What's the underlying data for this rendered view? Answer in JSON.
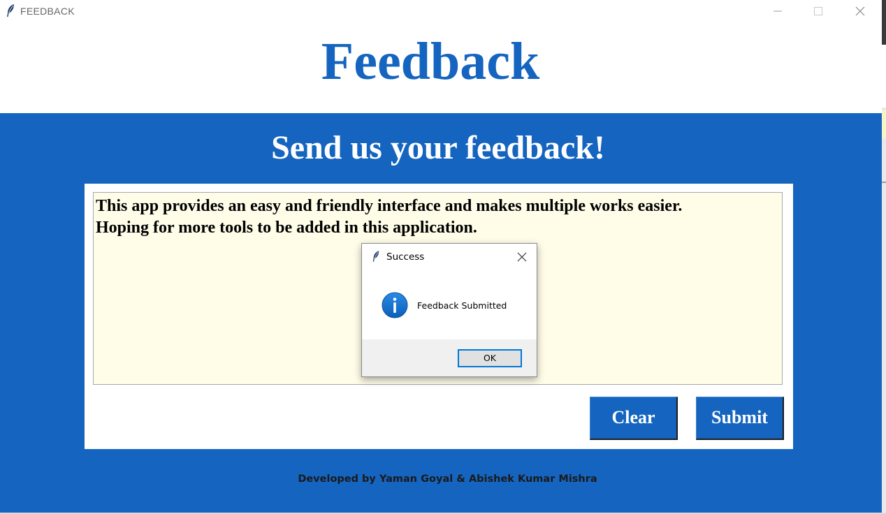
{
  "window": {
    "title": "FEEDBACK",
    "controls": [
      "minimize",
      "maximize",
      "close"
    ]
  },
  "header": {
    "title": "Feedback"
  },
  "form": {
    "subtitle": "Send us your feedback!",
    "feedback_lines": [
      "This app provides an easy and friendly interface and makes multiple works easier.",
      "Hoping for more tools to be added in this application."
    ],
    "clear_label": "Clear",
    "submit_label": "Submit"
  },
  "footer": {
    "credit": "Developed by Yaman Goyal & Abishek Kumar Mishra"
  },
  "dialog": {
    "title": "Success",
    "message": "Feedback Submitted",
    "ok_label": "OK",
    "icon": "info-icon"
  },
  "colors": {
    "brand_blue": "#1565c0",
    "textbox_bg": "#fffde8",
    "dialog_focus": "#0078d7"
  }
}
